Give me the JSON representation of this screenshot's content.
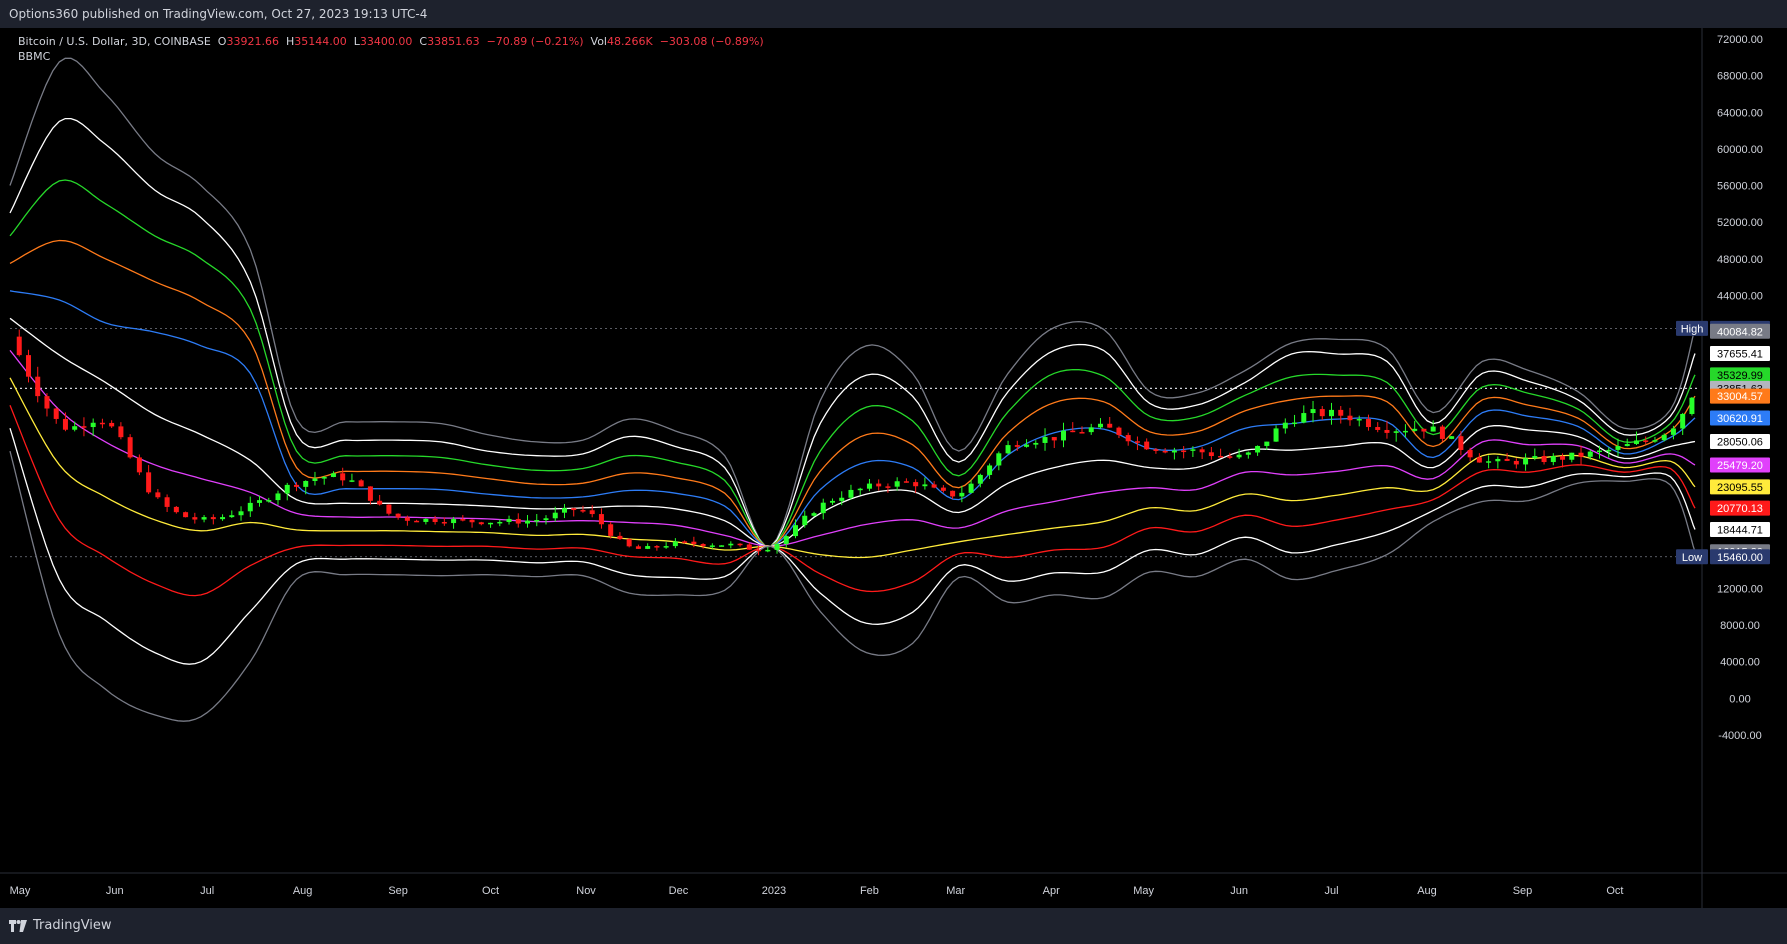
{
  "header": {
    "published": "Options360 published on TradingView.com, Oct 27, 2023 19:13 UTC-4"
  },
  "footer": {
    "brand": "TradingView"
  },
  "legend": {
    "symbol": "Bitcoin / U.S. Dollar, 3D, COINBASE",
    "o_label": "O",
    "o_val": "33921.66",
    "h_label": "H",
    "h_val": "35144.00",
    "l_label": "L",
    "l_val": "33400.00",
    "c_label": "C",
    "c_val": "33851.63",
    "change": "−70.89 (−0.21%)",
    "vol_label": "Vol",
    "vol_val": "48.266K",
    "vol_change": "−303.08 (−0.89%)",
    "indicator": "BBMC"
  },
  "chart_data": {
    "type": "line",
    "title": "Bitcoin / U.S. Dollar, 3D, COINBASE",
    "ylim": [
      -6000,
      74000
    ],
    "yticks": [
      "72000.00",
      "68000.00",
      "64000.00",
      "60000.00",
      "56000.00",
      "52000.00",
      "48000.00",
      "44000.00",
      "12000.00",
      "8000.00",
      "4000.00",
      "0.00",
      "-4000.00"
    ],
    "xticks": [
      "May",
      "Jun",
      "Jul",
      "Aug",
      "Sep",
      "Oct",
      "Nov",
      "Dec",
      "2023",
      "Feb",
      "Mar",
      "Apr",
      "May",
      "Jun",
      "Jul",
      "Aug",
      "Sep",
      "Oct"
    ],
    "x": [
      "2022-04-28",
      "2022-05-14",
      "2022-05-29",
      "2022-06-14",
      "2022-06-29",
      "2022-07-15",
      "2022-07-30",
      "2022-08-15",
      "2022-08-30",
      "2022-09-15",
      "2022-09-30",
      "2022-10-16",
      "2022-10-31",
      "2022-11-15",
      "2022-11-30",
      "2022-12-16",
      "2022-12-31",
      "2023-01-16",
      "2023-01-31",
      "2023-02-15",
      "2023-03-02",
      "2023-03-18",
      "2023-04-02",
      "2023-04-18",
      "2023-05-03",
      "2023-05-18",
      "2023-06-03",
      "2023-06-18",
      "2023-07-03",
      "2023-07-19",
      "2023-08-03",
      "2023-08-19",
      "2023-09-03",
      "2023-09-19",
      "2023-10-04",
      "2023-10-19",
      "2023-10-27"
    ],
    "price": [
      39500,
      30000,
      30200,
      22000,
      19500,
      21000,
      23500,
      24000,
      20000,
      19500,
      19300,
      19500,
      20500,
      16500,
      16900,
      16800,
      16600,
      21000,
      23000,
      23500,
      22400,
      27500,
      28500,
      29500,
      27500,
      27000,
      26500,
      30500,
      31000,
      29500,
      29300,
      26000,
      26000,
      26500,
      27500,
      29500,
      33851
    ],
    "series": [
      {
        "color": "#787b86",
        "values": [
          56000,
          69500,
          66000,
          59500,
          56000,
          49000,
          30500,
          30200,
          30200,
          30000,
          28800,
          28000,
          28200,
          30500,
          29200,
          26500,
          16600,
          32500,
          38500,
          35500,
          27000,
          35500,
          40500,
          40300,
          33500,
          33300,
          35800,
          38800,
          39200,
          38200,
          31200,
          36800,
          35800,
          33500,
          29500,
          31500,
          40400
        ]
      },
      {
        "color": "#ffffff",
        "values": [
          53000,
          63000,
          60500,
          55500,
          52500,
          45500,
          28800,
          28200,
          28200,
          28000,
          27000,
          26500,
          26700,
          28600,
          27500,
          25200,
          16600,
          30000,
          35300,
          33000,
          25800,
          33500,
          38000,
          38000,
          32200,
          32000,
          34500,
          37600,
          37600,
          36800,
          30000,
          35500,
          34600,
          32600,
          28800,
          30800,
          37655
        ]
      },
      {
        "color": "#26d82a",
        "values": [
          50500,
          56500,
          54000,
          50500,
          48000,
          42500,
          27000,
          26500,
          26500,
          26300,
          25500,
          24900,
          25100,
          26500,
          25800,
          23800,
          16600,
          27000,
          31800,
          30300,
          24300,
          31300,
          35500,
          35200,
          30800,
          30700,
          33100,
          35100,
          35300,
          34500,
          28800,
          34000,
          33300,
          31600,
          28000,
          30000,
          35330
        ]
      },
      {
        "color": "#ff7a1a",
        "values": [
          47500,
          50000,
          48000,
          45500,
          43300,
          39000,
          25200,
          24800,
          24800,
          24600,
          24000,
          23400,
          23500,
          24600,
          24100,
          22400,
          16600,
          24800,
          28800,
          27700,
          23000,
          29000,
          32300,
          32400,
          29100,
          29100,
          31400,
          32600,
          33000,
          32400,
          27500,
          32600,
          32000,
          30600,
          27300,
          29200,
          33005
        ]
      },
      {
        "color": "#2d7cf6",
        "values": [
          44500,
          43500,
          41000,
          40000,
          38500,
          35500,
          23300,
          22900,
          22900,
          22800,
          22300,
          21900,
          22000,
          22700,
          22400,
          21000,
          16600,
          22800,
          25800,
          25200,
          21700,
          26600,
          29000,
          29400,
          27300,
          27400,
          29500,
          30000,
          30500,
          30200,
          26300,
          31200,
          30800,
          29700,
          26700,
          28500,
          30621
        ]
      },
      {
        "color": "#ffffff",
        "values": [
          41500,
          37500,
          34500,
          31000,
          28800,
          26000,
          21700,
          21300,
          21300,
          21200,
          21000,
          20700,
          20800,
          21000,
          20700,
          19400,
          16600,
          20200,
          22300,
          22600,
          20300,
          23500,
          25200,
          26000,
          25200,
          25200,
          27100,
          27100,
          27500,
          27800,
          25200,
          29500,
          29300,
          28600,
          26200,
          27500,
          28050
        ]
      },
      {
        "color": "#e040fb",
        "values": [
          38000,
          31500,
          28000,
          25500,
          24000,
          22500,
          20200,
          19800,
          19800,
          19700,
          19600,
          19300,
          19400,
          19200,
          18900,
          17800,
          16600,
          17800,
          19000,
          19500,
          18600,
          20500,
          21500,
          22500,
          23000,
          22800,
          24700,
          24400,
          24800,
          25400,
          24000,
          28000,
          27700,
          27600,
          25700,
          26700,
          25479
        ]
      },
      {
        "color": "#ffeb3b",
        "values": [
          35000,
          25500,
          22000,
          19500,
          18300,
          19200,
          18400,
          18300,
          18300,
          18200,
          18100,
          17800,
          17900,
          17400,
          17100,
          16200,
          16600,
          15700,
          15400,
          16200,
          17100,
          17900,
          18600,
          19300,
          20800,
          20500,
          22300,
          21600,
          22200,
          23000,
          22800,
          26500,
          26200,
          26500,
          25200,
          25900,
          23096
        ]
      },
      {
        "color": "#ff1a1a",
        "values": [
          32000,
          19500,
          15500,
          12500,
          11300,
          14500,
          16500,
          16700,
          16700,
          16600,
          16600,
          16300,
          16400,
          15500,
          15300,
          14700,
          16600,
          13600,
          11700,
          12700,
          15800,
          15400,
          16200,
          16500,
          18600,
          18200,
          20000,
          18800,
          19500,
          20600,
          21700,
          24800,
          24700,
          25500,
          24700,
          25100,
          20770
        ]
      },
      {
        "color": "#ffffff",
        "values": [
          29500,
          13000,
          8500,
          5000,
          4000,
          9500,
          14700,
          15200,
          15200,
          15100,
          15100,
          14800,
          14900,
          13500,
          13200,
          13300,
          16600,
          11500,
          8200,
          9400,
          14500,
          12800,
          13700,
          13800,
          16200,
          15700,
          17600,
          15900,
          16800,
          18200,
          20500,
          23100,
          23100,
          24500,
          24200,
          24200,
          18445
        ]
      },
      {
        "color": "#787b86",
        "values": [
          27000,
          7000,
          1000,
          -1800,
          -2000,
          4000,
          13000,
          13500,
          13500,
          13400,
          13500,
          13300,
          13400,
          11500,
          11300,
          11800,
          16600,
          9500,
          5000,
          6000,
          13200,
          10500,
          11300,
          11000,
          13800,
          13300,
          15200,
          13000,
          14000,
          15700,
          19300,
          21500,
          21600,
          23500,
          23700,
          23300,
          16015
        ]
      }
    ],
    "last_values": [
      {
        "label": "High",
        "value": "40400.00",
        "color": "#2a3a6e"
      },
      {
        "value": "40084.82",
        "color": "#787b86"
      },
      {
        "value": "37655.41",
        "color": "#ffffff"
      },
      {
        "value": "35329.99",
        "color": "#26d82a"
      },
      {
        "value": "33851.63",
        "color": "#b2b5be"
      },
      {
        "value": "33004.57",
        "color": "#ff7a1a"
      },
      {
        "value": "30620.91",
        "color": "#2d7cf6"
      },
      {
        "value": "28050.06",
        "color": "#ffffff"
      },
      {
        "value": "25479.20",
        "color": "#e040fb"
      },
      {
        "value": "23095.55",
        "color": "#ffeb3b"
      },
      {
        "value": "20770.13",
        "color": "#ff1a1a"
      },
      {
        "value": "18444.71",
        "color": "#ffffff"
      },
      {
        "value": "16015.30",
        "color": "#787b86"
      },
      {
        "label": "Low",
        "value": "15460.00",
        "color": "#2a3a6e"
      }
    ],
    "hlines": [
      40400,
      33851.63,
      15460
    ],
    "grid": false,
    "legend": "top-left"
  }
}
